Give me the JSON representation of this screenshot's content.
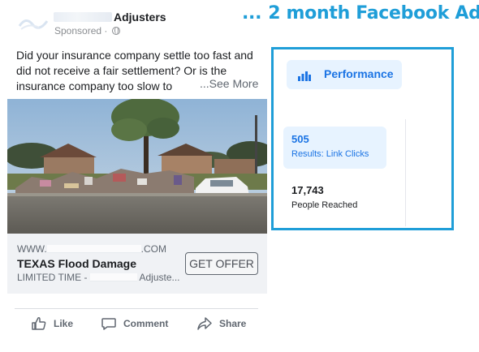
{
  "ad": {
    "page_name": "Adjusters",
    "sponsored": "Sponsored ·",
    "body_lines": [
      "Did your insurance company settle too fast and",
      "did not receive a fair settlement? Or is the",
      "insurance company too slow to"
    ],
    "see_more": "...See More",
    "link": {
      "domain_prefix": "WWW.",
      "domain_suffix": ".COM",
      "title": "TEXAS Flood Damage",
      "desc_prefix": "LIMITED TIME -",
      "desc_suffix": "Adjuste...",
      "cta": "GET OFFER"
    },
    "actions": {
      "like": "Like",
      "comment": "Comment",
      "share": "Share"
    }
  },
  "annotation": {
    "dots": "...",
    "text": "2 month  Facebook Ad"
  },
  "performance": {
    "tab_label": "Performance",
    "metrics": [
      {
        "value": "505",
        "label": "Results: Link Clicks"
      },
      {
        "value": "17,743",
        "label": "People Reached"
      }
    ]
  },
  "colors": {
    "accent": "#1f9ed8",
    "facebook_blue": "#1b74e4",
    "highlight_bg": "#e7f3ff"
  },
  "icons": [
    "globe-icon",
    "bar-chart-icon",
    "like-icon",
    "comment-icon",
    "share-icon"
  ]
}
